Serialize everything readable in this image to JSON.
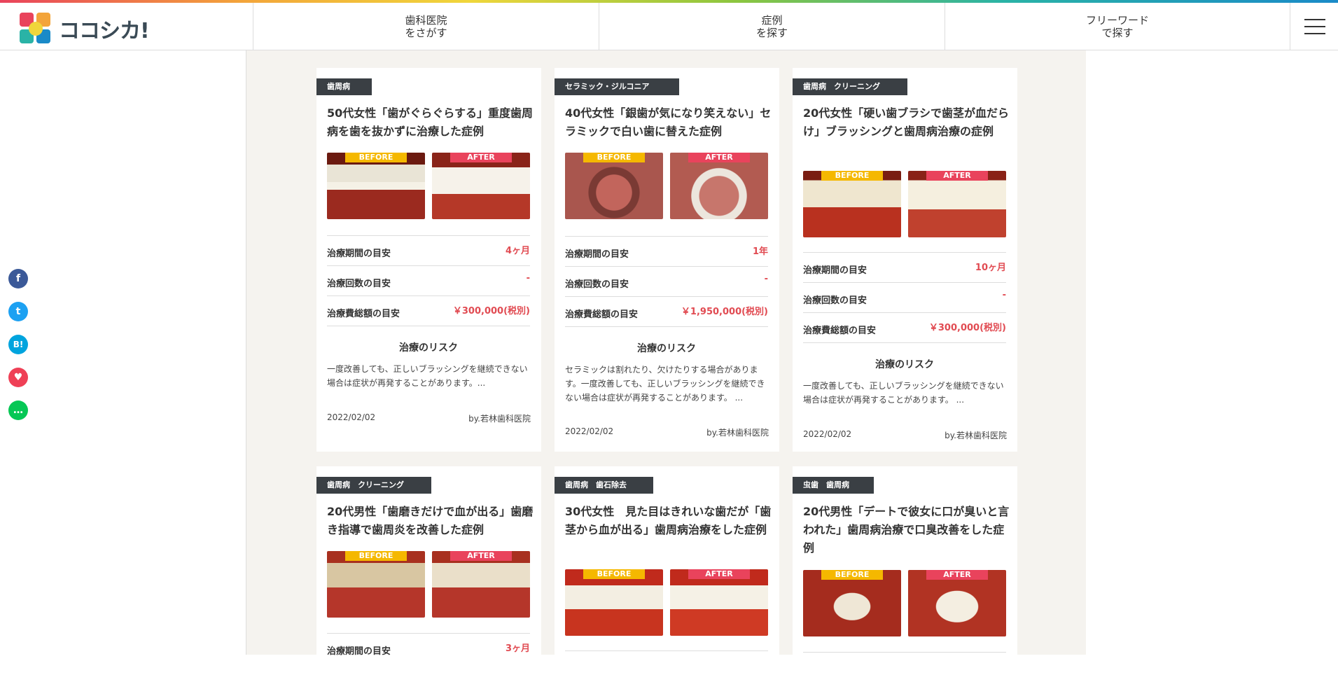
{
  "header": {
    "logo_text": "ココシカ!",
    "nav": [
      {
        "line1": "歯科医院",
        "line2": "をさがす"
      },
      {
        "line1": "症例",
        "line2": "を探す"
      },
      {
        "line1": "フリーワード",
        "line2": "で探す"
      }
    ],
    "menu_icon": "hamburger-menu-icon"
  },
  "social": [
    {
      "name": "facebook",
      "glyph": "f",
      "color": "#3b5998"
    },
    {
      "name": "twitter",
      "glyph": "t",
      "color": "#1da1f2"
    },
    {
      "name": "hatena",
      "glyph": "B!",
      "color": "#00a4de"
    },
    {
      "name": "pocket",
      "glyph": "♥",
      "color": "#ef4056"
    },
    {
      "name": "line",
      "glyph": "…",
      "color": "#06c755"
    }
  ],
  "image_labels": {
    "before": "BEFORE",
    "after": "AFTER"
  },
  "labels": {
    "period": "治療期間の目安",
    "count": "治療回数の目安",
    "cost": "治療費総額の目安",
    "risk": "治療のリスク"
  },
  "cards": [
    {
      "tag": "歯周病",
      "title": "50代女性「歯がぐらぐらする」重度歯周病を歯を抜かずに治療した症例",
      "period": "4ヶ月",
      "count": "-",
      "cost": "￥300,000(税別)",
      "risk": "一度改善しても、正しいブラッシングを継続できない場合は症状が再発することがあります。...",
      "date": "2022/02/02",
      "by": "by.若林歯科医院"
    },
    {
      "tag": "セラミック・ジルコニア",
      "title": "40代女性「銀歯が気になり笑えない」セラミックで白い歯に替えた症例",
      "period": "1年",
      "count": "-",
      "cost": "￥1,950,000(税別)",
      "risk": "セラミックは割れたり、欠けたりする場合があります。一度改善しても、正しいブラッシングを継続できない場合は症状が再発することがあります。 ...",
      "date": "2022/02/02",
      "by": "by.若林歯科医院"
    },
    {
      "tag": "歯周病　クリーニング",
      "title": "20代女性「硬い歯ブラシで歯茎が血だらけ」ブラッシングと歯周病治療の症例",
      "period": "10ヶ月",
      "count": "-",
      "cost": "￥300,000(税別)",
      "risk": "一度改善しても、正しいブラッシングを継続できない場合は症状が再発することがあります。 ...",
      "date": "2022/02/02",
      "by": "by.若林歯科医院"
    },
    {
      "tag": "歯周病　クリーニング",
      "title": "20代男性「歯磨きだけで血が出る」歯磨き指導で歯周炎を改善した症例",
      "period": "3ヶ月"
    },
    {
      "tag": "歯周病　歯石除去",
      "title": "30代女性　見た目はきれいな歯だが「歯茎から血が出る」歯周病治療をした症例"
    },
    {
      "tag": "虫歯　歯周病",
      "title": "20代男性「デートで彼女に口が臭いと言われた」歯周病治療で口臭改善をした症例"
    }
  ]
}
